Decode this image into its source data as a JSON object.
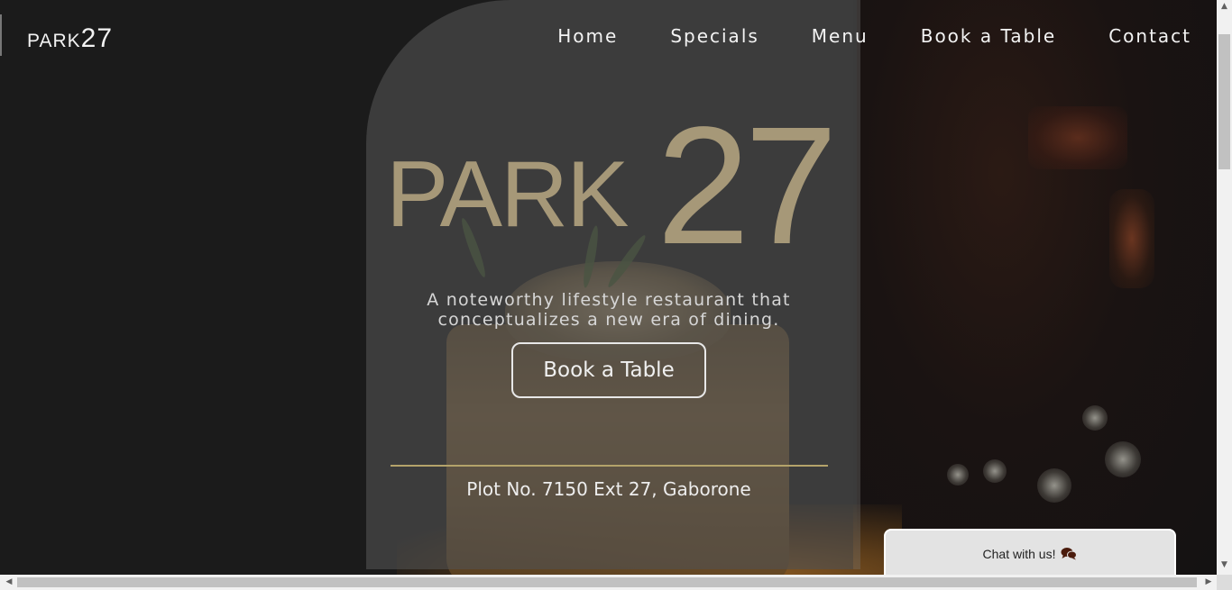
{
  "nav": {
    "brand_park": "PARK",
    "brand_num": "27",
    "items": [
      {
        "label": "Home"
      },
      {
        "label": "Specials"
      },
      {
        "label": "Menu"
      },
      {
        "label": "Book a Table"
      },
      {
        "label": "Contact"
      }
    ]
  },
  "hero": {
    "logo_park": "PARK",
    "logo_num": "27",
    "tagline_line1": "A noteworthy lifestyle restaurant that",
    "tagline_line2": "conceptualizes a new era of dining.",
    "book_button": "Book a Table",
    "address": "Plot No. 7150 Ext 27, Gaborone"
  },
  "chat": {
    "label": "Chat with us!",
    "icon": "chat-bubbles-icon"
  },
  "colors": {
    "gold": "#a69878",
    "divider": "#b4a36a",
    "background": "#1b1b1b"
  }
}
